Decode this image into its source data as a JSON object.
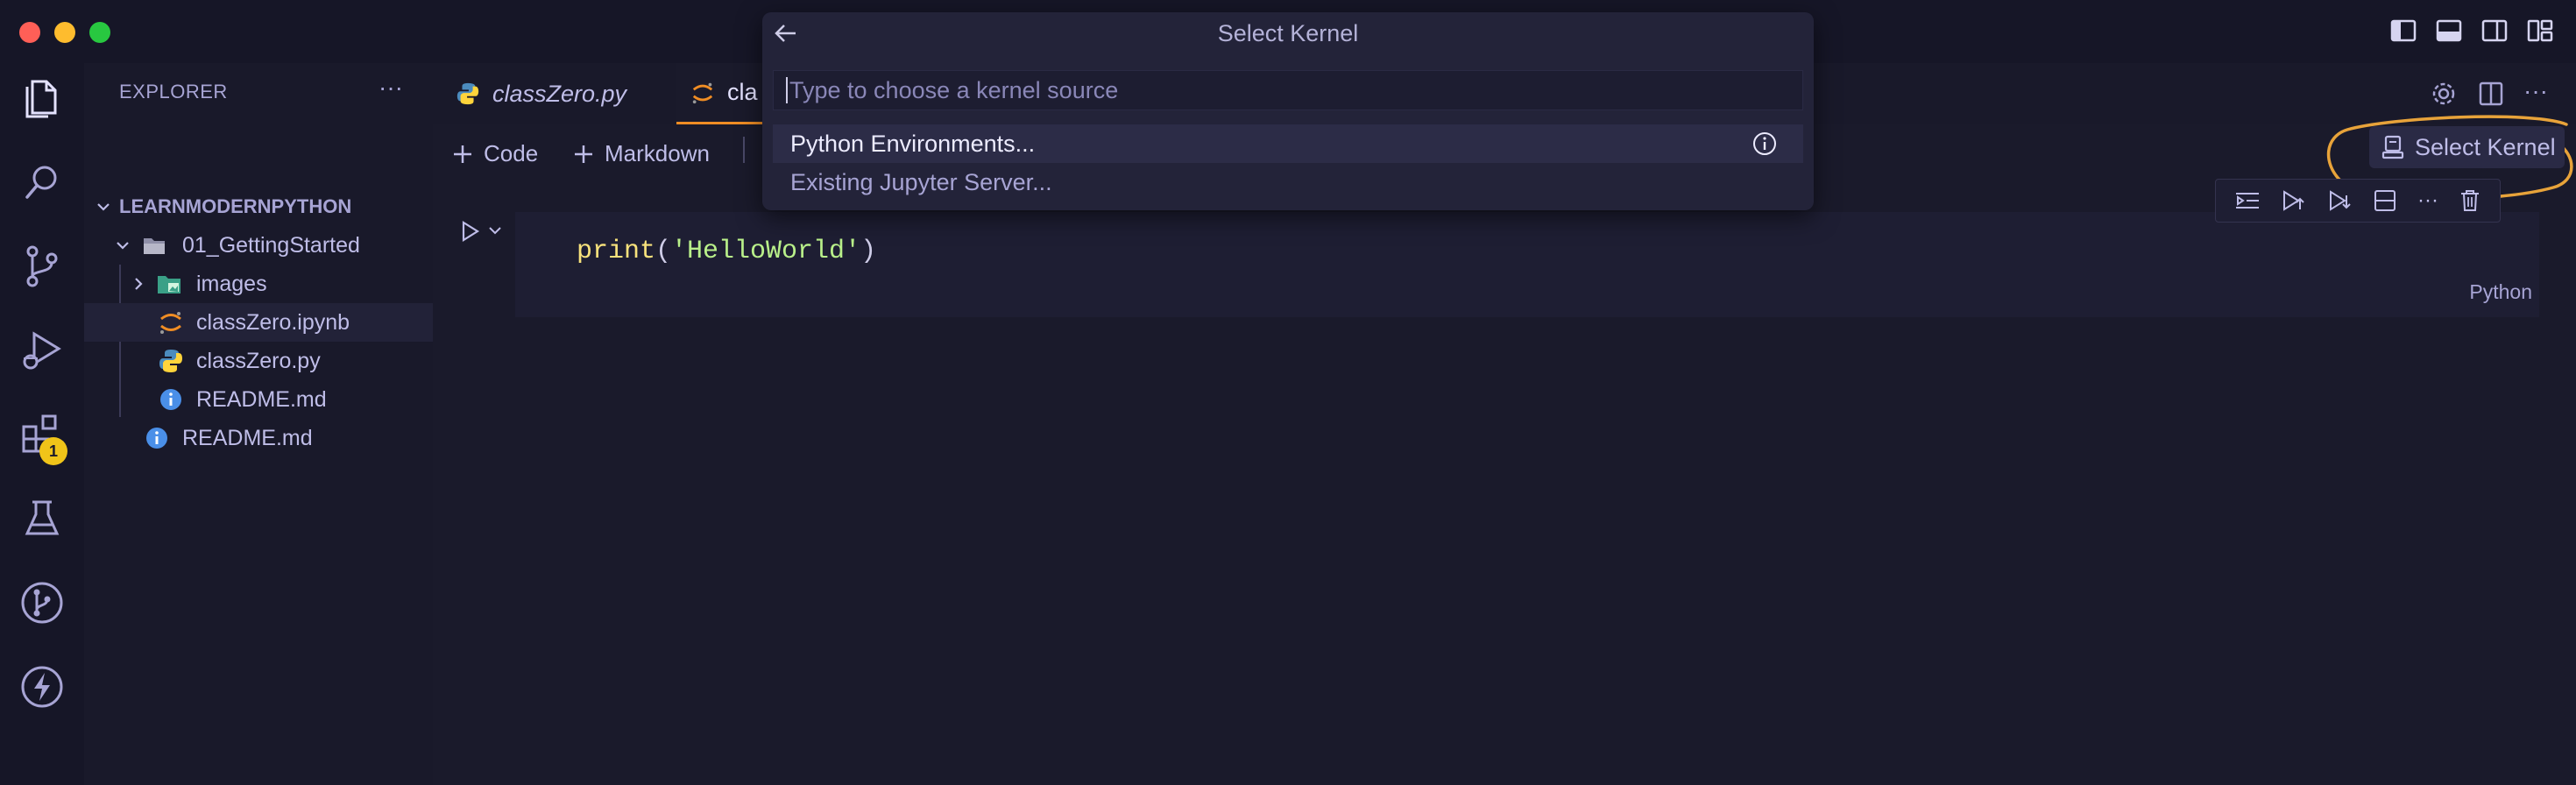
{
  "window": {
    "traffic_colors": [
      "#ff5f57",
      "#febc2e",
      "#28c840"
    ]
  },
  "activity": {
    "items": [
      "explorer-icon",
      "search-icon",
      "source-control-icon",
      "run-debug-icon",
      "extensions-icon",
      "testing-icon",
      "git-graph-icon",
      "lightning-icon"
    ],
    "extensions_badge": "1"
  },
  "explorer": {
    "title": "EXPLORER",
    "more": "···",
    "project": "LEARNMODERNPYTHON",
    "tree": {
      "folder": "01_GettingStarted",
      "images": "images",
      "notebook": "classZero.ipynb",
      "pyfile": "classZero.py",
      "readme_inner": "README.md",
      "readme_root": "README.md"
    }
  },
  "tabs": {
    "tab1": "classZero.py",
    "tab2": "cla"
  },
  "toolbar": {
    "code": "Code",
    "markdown": "Markdown",
    "more": "···",
    "select_kernel": "Select Kernel"
  },
  "cell": {
    "code": "print('HelloWorld')",
    "language": "Python"
  },
  "quickpick": {
    "title": "Select Kernel",
    "placeholder": "Type to choose a kernel source",
    "items": [
      "Python Environments...",
      "Existing Jupyter Server..."
    ]
  },
  "colors": {
    "background": "#1a1a2b",
    "accent": "#f08d24",
    "annotation": "#e8a33a",
    "python_blue": "#4b8bbe",
    "python_yellow": "#ffd43b"
  }
}
